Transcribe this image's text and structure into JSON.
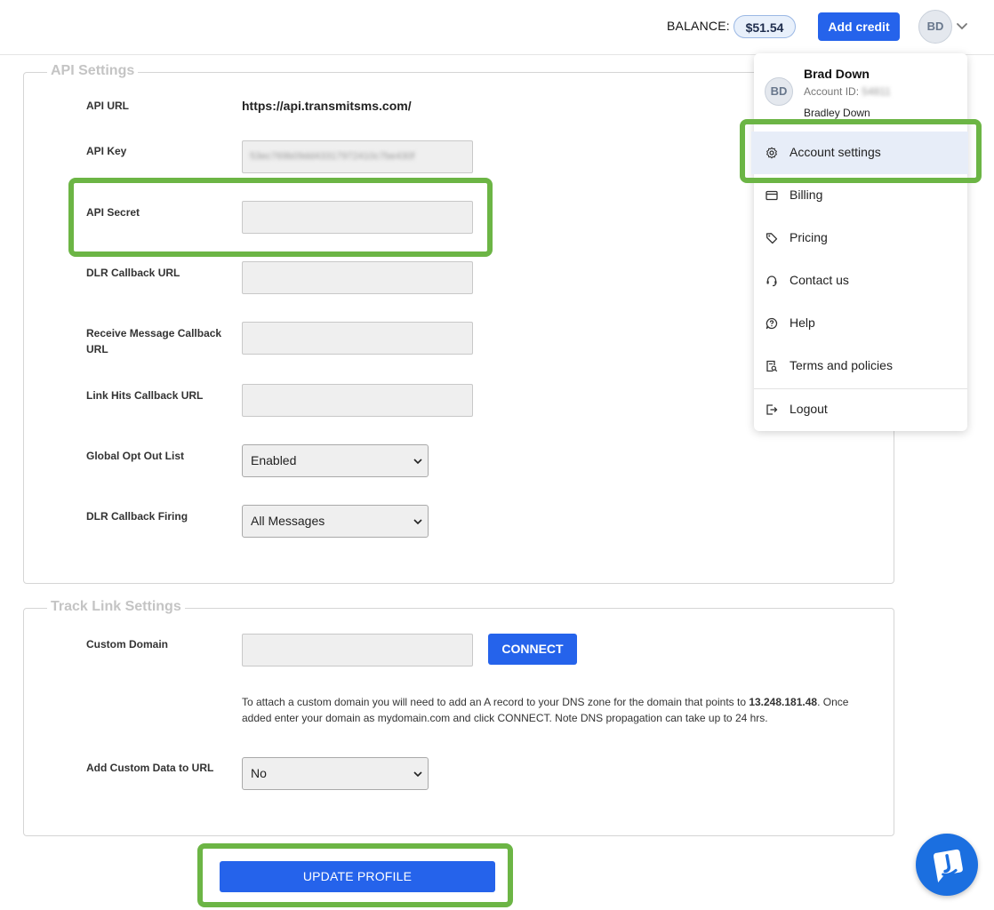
{
  "header": {
    "balance_label": "BALANCE:",
    "balance_value": "$51.54",
    "add_credit_label": "Add credit",
    "avatar_initials": "BD"
  },
  "api_settings": {
    "legend": "API Settings",
    "api_url_label": "API URL",
    "api_url_value": "https://api.transmitsms.com/",
    "api_key_label": "API Key",
    "api_key_value": "53ec769b09dd43317972410c7be430f",
    "api_secret_label": "API Secret",
    "dlr_callback_label": "DLR Callback URL",
    "receive_callback_label": "Receive Message Callback URL",
    "link_hits_label": "Link Hits Callback URL",
    "opt_out_label": "Global Opt Out List",
    "opt_out_value": "Enabled",
    "dlr_firing_label": "DLR Callback Firing",
    "dlr_firing_value": "All Messages"
  },
  "track_link": {
    "legend": "Track Link Settings",
    "custom_domain_label": "Custom Domain",
    "connect_label": "CONNECT",
    "help_text_1": "To attach a custom domain you will need to add an A record to your DNS zone for the domain that points to ",
    "help_ip": "13.248.181.48",
    "help_text_2": ". Once added enter your domain as mydomain.com and click CONNECT. Note DNS propagation can take up to 24 hrs.",
    "custom_data_label": "Add Custom Data to URL",
    "custom_data_value": "No"
  },
  "update_label": "UPDATE PROFILE",
  "user_menu": {
    "initials": "BD",
    "name": "Brad Down",
    "account_id_label": "Account ID:",
    "account_id_value": "54811",
    "full_name": "Bradley Down",
    "items": [
      {
        "label": "Account settings",
        "icon": "gear-icon"
      },
      {
        "label": "Billing",
        "icon": "credit-card-icon"
      },
      {
        "label": "Pricing",
        "icon": "tag-icon"
      },
      {
        "label": "Contact us",
        "icon": "headset-icon"
      },
      {
        "label": "Help",
        "icon": "help-icon"
      },
      {
        "label": "Terms and policies",
        "icon": "document-search-icon"
      },
      {
        "label": "Logout",
        "icon": "logout-icon"
      }
    ]
  },
  "colors": {
    "primary": "#2563eb",
    "highlight": "#6cb545",
    "active_menu": "#e7edf8"
  }
}
